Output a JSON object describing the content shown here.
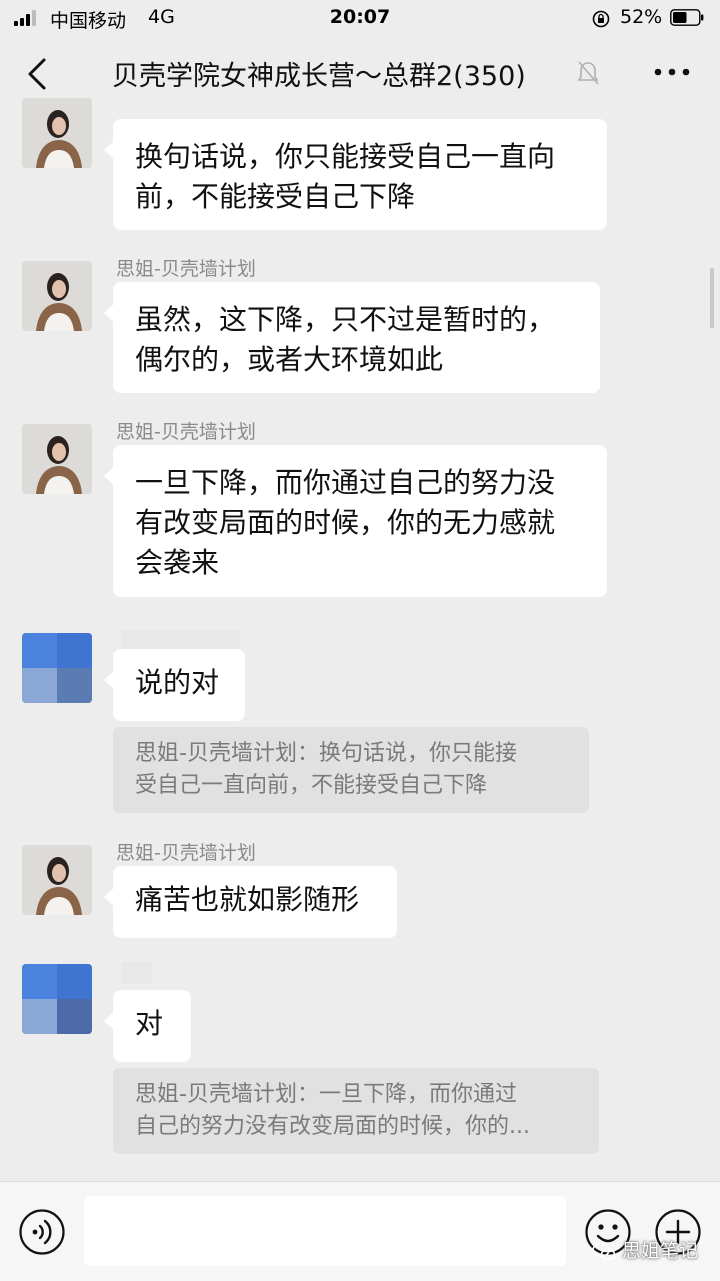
{
  "status_bar": {
    "carrier": "中国移动",
    "network": "4G",
    "time": "20:07",
    "battery": "52%"
  },
  "header": {
    "title": "贝壳学院女神成长营～总群2(350)"
  },
  "messages": [
    {
      "kind": "text",
      "sender": "",
      "lines": [
        "换句话说，你只能接受自己一直向",
        "前，不能接受自己下降"
      ]
    },
    {
      "kind": "text",
      "sender": "思姐-贝壳墙计划",
      "lines": [
        "虽然，这下降，只不过是暂时的，",
        "偶尔的，或者大环境如此"
      ]
    },
    {
      "kind": "text",
      "sender": "思姐-贝壳墙计划",
      "lines": [
        "一旦下降，而你通过自己的努力没",
        "有改变局面的时候，你的无力感就",
        "会袭来"
      ]
    },
    {
      "kind": "reply",
      "text": "说的对",
      "quote_lines": [
        "思姐-贝壳墙计划：换句话说，你只能接",
        "受自己一直向前，不能接受自己下降"
      ]
    },
    {
      "kind": "text",
      "sender": "思姐-贝壳墙计划",
      "lines": [
        "痛苦也就如影随形"
      ]
    },
    {
      "kind": "reply",
      "text": "对",
      "quote_lines": [
        "思姐-贝壳墙计划：一旦下降，而你通过",
        "自己的努力没有改变局面的时候，你的..."
      ]
    }
  ],
  "input": {
    "placeholder": ""
  },
  "watermark": {
    "text": "思姐笔记"
  },
  "colors": {
    "background": "#ededed",
    "bubble": "#ffffff",
    "quote": "#e1e1e1",
    "sender": "#8a8a8a"
  }
}
